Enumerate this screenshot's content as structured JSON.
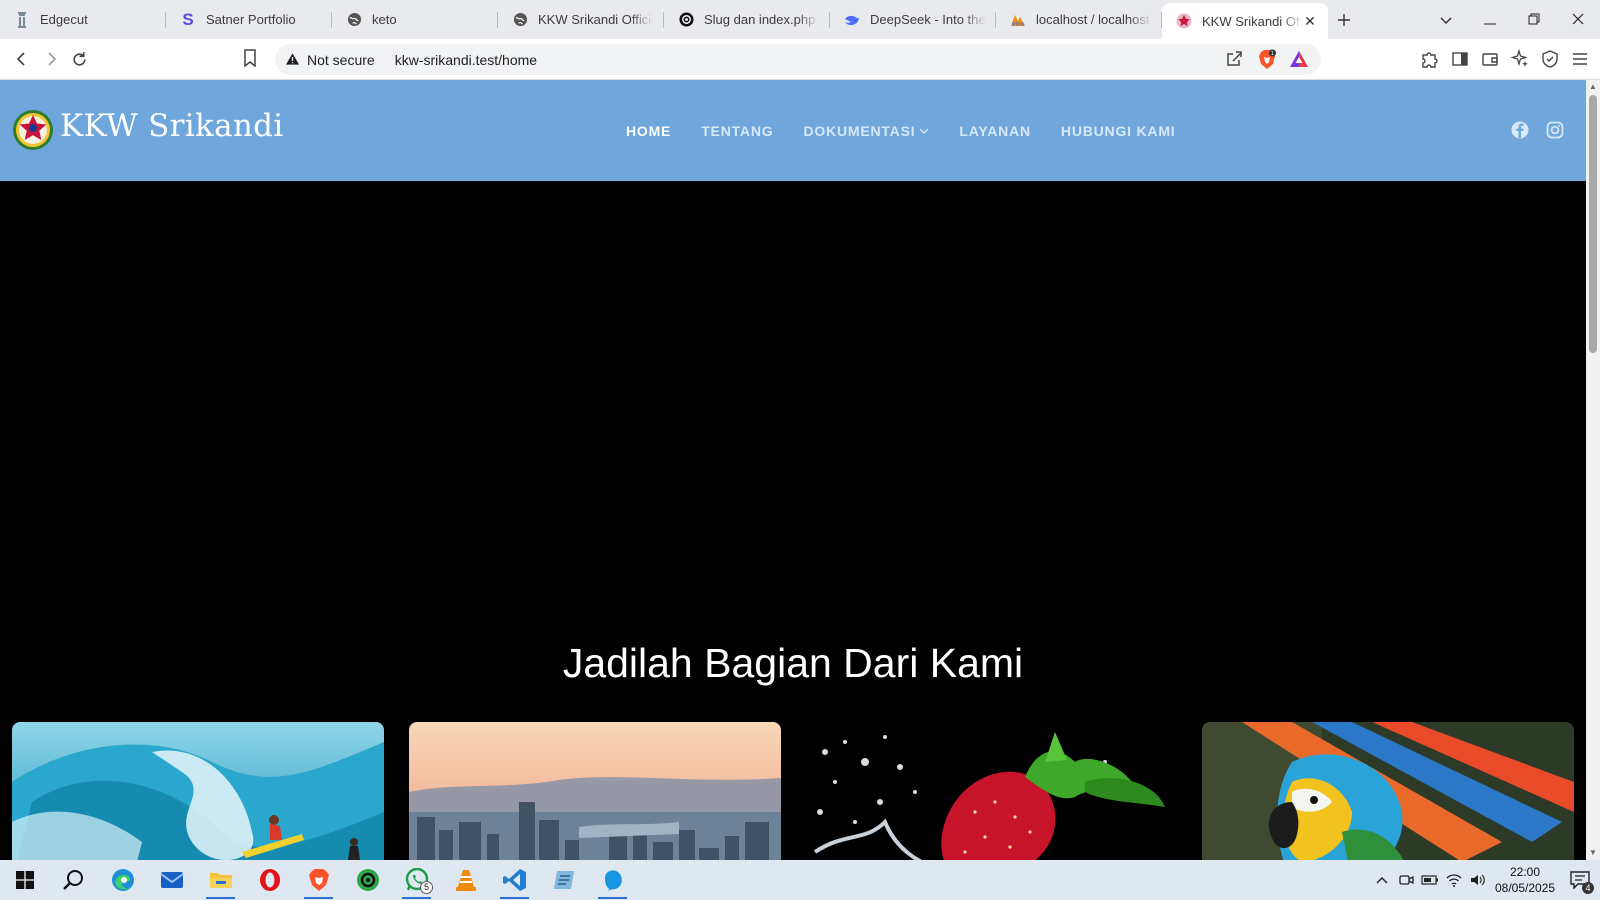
{
  "browser": {
    "tabs": [
      {
        "title": "Edgecut",
        "icon": "edgecut-icon"
      },
      {
        "title": "Satner Portfolio",
        "icon": "s-icon"
      },
      {
        "title": "keto",
        "icon": "globe-icon"
      },
      {
        "title": "KKW Srikandi Official W",
        "icon": "globe-icon"
      },
      {
        "title": "Slug dan index.php",
        "icon": "chatgpt-icon"
      },
      {
        "title": "DeepSeek - Into the Un",
        "icon": "deepseek-icon"
      },
      {
        "title": "localhost / localhost / d",
        "icon": "phpmyadmin-icon"
      },
      {
        "title": "KKW Srikandi Official W",
        "icon": "site-logo-icon",
        "active": true
      }
    ],
    "security_label": "Not secure",
    "url": "kkw-srikandi.test/home",
    "shield_count": "1"
  },
  "site": {
    "brand": "KKW Srikandi",
    "nav": [
      {
        "label": "HOME",
        "active": true
      },
      {
        "label": "TENTANG"
      },
      {
        "label": "DOKUMENTASI",
        "dropdown": true
      },
      {
        "label": "LAYANAN"
      },
      {
        "label": "HUBUNGI KAMI"
      }
    ],
    "hero_title": "Jadilah Bagian Dari Kami",
    "cards": [
      {
        "image": "surfer-wave-image"
      },
      {
        "image": "city-skyline-image"
      },
      {
        "image": "strawberry-splash-image"
      },
      {
        "image": "macaw-parrot-image"
      }
    ]
  },
  "taskbar": {
    "time": "22:00",
    "date": "08/05/2025",
    "whatsapp_badge": "5",
    "notification_count": "4"
  },
  "colors": {
    "header_bg": "#6fa7dc",
    "page_bg": "#000000",
    "tabstrip_bg": "#e9eaed",
    "taskbar_bg": "#dfe7f0"
  }
}
